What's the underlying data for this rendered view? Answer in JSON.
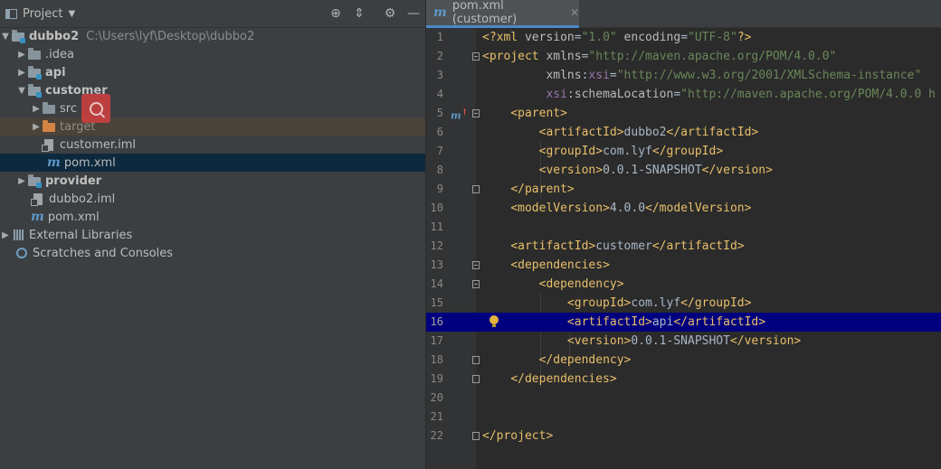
{
  "project_panel": {
    "title": "Project",
    "tree": [
      {
        "label": "dubbo2",
        "path": "C:\\Users\\lyf\\Desktop\\dubbo2",
        "arrow": "▼"
      },
      {
        "label": ".idea",
        "arrow": "▶"
      },
      {
        "label": "api",
        "arrow": "▶"
      },
      {
        "label": "customer",
        "arrow": "▼"
      },
      {
        "label": "src",
        "arrow": "▶"
      },
      {
        "label": "target",
        "arrow": "▶"
      },
      {
        "label": "customer.iml"
      },
      {
        "label": "pom.xml"
      },
      {
        "label": "provider",
        "arrow": "▶"
      },
      {
        "label": "dubbo2.iml"
      },
      {
        "label": "pom.xml"
      },
      {
        "label": "External Libraries",
        "arrow": "▶"
      },
      {
        "label": "Scratches and Consoles"
      }
    ]
  },
  "editor": {
    "tab_label": "pom.xml (customer)",
    "current_line": 16,
    "lines": [
      {
        "n": "1"
      },
      {
        "n": "2"
      },
      {
        "n": "3"
      },
      {
        "n": "4"
      },
      {
        "n": "5"
      },
      {
        "n": "6"
      },
      {
        "n": "7"
      },
      {
        "n": "8"
      },
      {
        "n": "9"
      },
      {
        "n": "10"
      },
      {
        "n": "11"
      },
      {
        "n": "12"
      },
      {
        "n": "13"
      },
      {
        "n": "14"
      },
      {
        "n": "15"
      },
      {
        "n": "16"
      },
      {
        "n": "17"
      },
      {
        "n": "18"
      },
      {
        "n": "19"
      },
      {
        "n": "20"
      },
      {
        "n": "21"
      },
      {
        "n": "22"
      }
    ],
    "code": {
      "l1_ver": "\"1.0\"",
      "l1_enc": "\"UTF-8\"",
      "l2_xmlns": "\"http://maven.apache.org/POM/4.0.0\"",
      "l3_xsi": "\"http://www.w3.org/2001/XMLSchema-instance\"",
      "l4_loc": "\"http://maven.apache.org/POM/4.0.0 h",
      "parent_artifact": "dubbo2",
      "parent_group": "com.lyf",
      "parent_version": "0.0.1-SNAPSHOT",
      "model_version": "4.0.0",
      "artifact": "customer",
      "dep_group": "com.lyf",
      "dep_artifact": "api",
      "dep_version": "0.0.1-SNAPSHOT"
    }
  },
  "colors": {
    "tag": "#e8bf6a",
    "string": "#6a8759",
    "namespace": "#9876aa",
    "current_line_bg": "#00007f",
    "selection_bg": "#0d293e"
  }
}
